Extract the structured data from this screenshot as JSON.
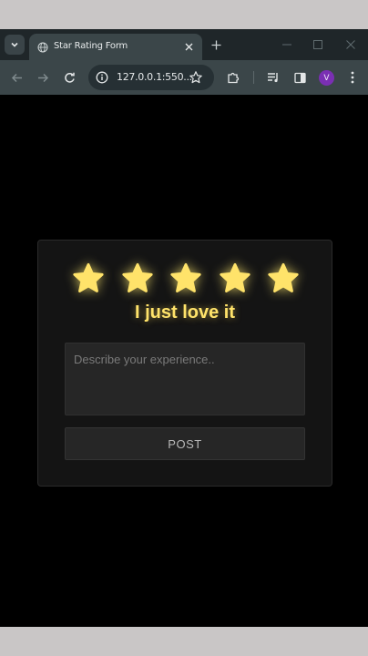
{
  "browser": {
    "tab_title": "Star Rating Form",
    "url": "127.0.0.1:550...",
    "avatar_letter": "V"
  },
  "form": {
    "stars": [
      {
        "state": "filled"
      },
      {
        "state": "filled"
      },
      {
        "state": "filled"
      },
      {
        "state": "filled"
      },
      {
        "state": "filled"
      }
    ],
    "rating": 5,
    "rating_text": "I just love it",
    "placeholder": "Describe your experience..",
    "post_label": "POST"
  },
  "colors": {
    "star": "#ffe36a",
    "background": "#000000",
    "card": "#141414"
  }
}
